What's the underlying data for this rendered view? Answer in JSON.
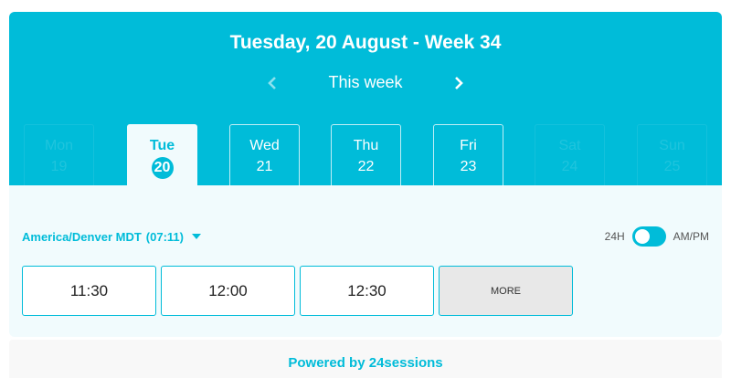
{
  "header": {
    "title": "Tuesday, 20 August - Week 34",
    "week_label": "This week",
    "accent_color": "#00bcd9"
  },
  "days": [
    {
      "name": "Mon",
      "num": "19",
      "state": "disabled"
    },
    {
      "name": "Tue",
      "num": "20",
      "state": "active"
    },
    {
      "name": "Wed",
      "num": "21",
      "state": "available"
    },
    {
      "name": "Thu",
      "num": "22",
      "state": "available"
    },
    {
      "name": "Fri",
      "num": "23",
      "state": "available"
    },
    {
      "name": "Sat",
      "num": "24",
      "state": "disabled"
    },
    {
      "name": "Sun",
      "num": "25",
      "state": "disabled"
    }
  ],
  "timezone": {
    "label": "America/Denver MDT",
    "current_time": "(07:11)"
  },
  "time_format": {
    "left": "24H",
    "right": "AM/PM"
  },
  "slots": [
    "11:30",
    "12:00",
    "12:30"
  ],
  "more_label": "MORE",
  "footer": {
    "powered_by": "Powered by 24sessions"
  },
  "icons": [
    "chevron-left-icon",
    "chevron-right-icon",
    "caret-down-icon"
  ]
}
